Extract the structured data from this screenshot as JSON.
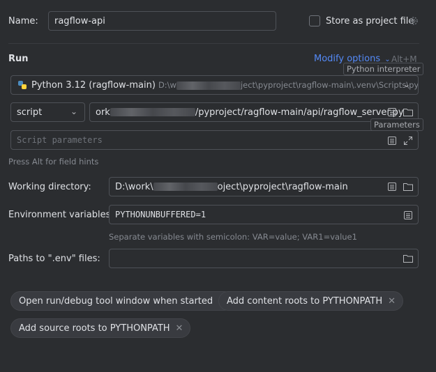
{
  "name": {
    "label": "Name:",
    "value": "ragflow-api"
  },
  "store_as_project_file": {
    "label": "Store as project file",
    "checked": false
  },
  "run": {
    "section_title": "Run",
    "modify_options": "Modify options",
    "modify_shortcut": "Alt+M",
    "tooltip_interpreter": "Python interpreter",
    "interpreter": {
      "name": "Python 3.12 (ragflow-main)",
      "path_start": "D:\\w",
      "path_end": "ject\\pyproject\\ragflow-main\\.venv\\Scripts\\py"
    },
    "script_type": "script",
    "script_path": {
      "start": "ork",
      "end": "/pyproject/ragflow-main/api/ragflow_server.py"
    },
    "tooltip_parameters": "Parameters",
    "script_params_placeholder": "Script parameters",
    "field_hint": "Press Alt for field hints"
  },
  "working_dir": {
    "label": "Working directory:",
    "value_start": "D:\\work\\",
    "value_end": "oject\\pyproject\\ragflow-main"
  },
  "env_vars": {
    "label": "Environment variables:",
    "value": "PYTHONUNBUFFERED=1",
    "hint": "Separate variables with semicolon: VAR=value; VAR1=value1"
  },
  "env_files": {
    "label": "Paths to \".env\" files:",
    "value": ""
  },
  "chips": [
    {
      "label": "Open run/debug tool window when started"
    },
    {
      "label": "Add content roots to PYTHONPATH"
    },
    {
      "label": "Add source roots to PYTHONPATH"
    }
  ]
}
